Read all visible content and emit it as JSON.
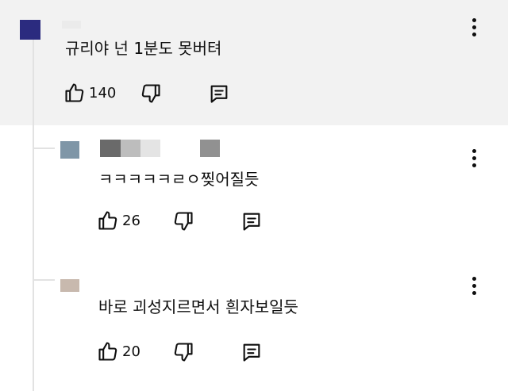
{
  "colors": {
    "parent_background": "#f2f2f2",
    "thread_line": "#e2e2e2",
    "text": "#0f0f0f",
    "parent_avatar": "#2b2b7f",
    "reply1_avatar": "#7f96a7",
    "reply2_avatar": "#c8b9ae"
  },
  "comments": [
    {
      "text": "규리야 넌 1분도 못버텨",
      "likes": "140",
      "icons": [
        "thumbs-up-icon",
        "thumbs-down-icon",
        "reply-icon",
        "more-vertical-icon"
      ]
    },
    {
      "text": "ㅋㅋㅋㅋㅋㄹㅇ찢어질듯",
      "likes": "26",
      "icons": [
        "thumbs-up-icon",
        "thumbs-down-icon",
        "reply-icon",
        "more-vertical-icon"
      ]
    },
    {
      "text": "바로 괴성지르면서 흰자보일듯",
      "likes": "20",
      "icons": [
        "thumbs-up-icon",
        "thumbs-down-icon",
        "reply-icon",
        "more-vertical-icon"
      ]
    }
  ]
}
